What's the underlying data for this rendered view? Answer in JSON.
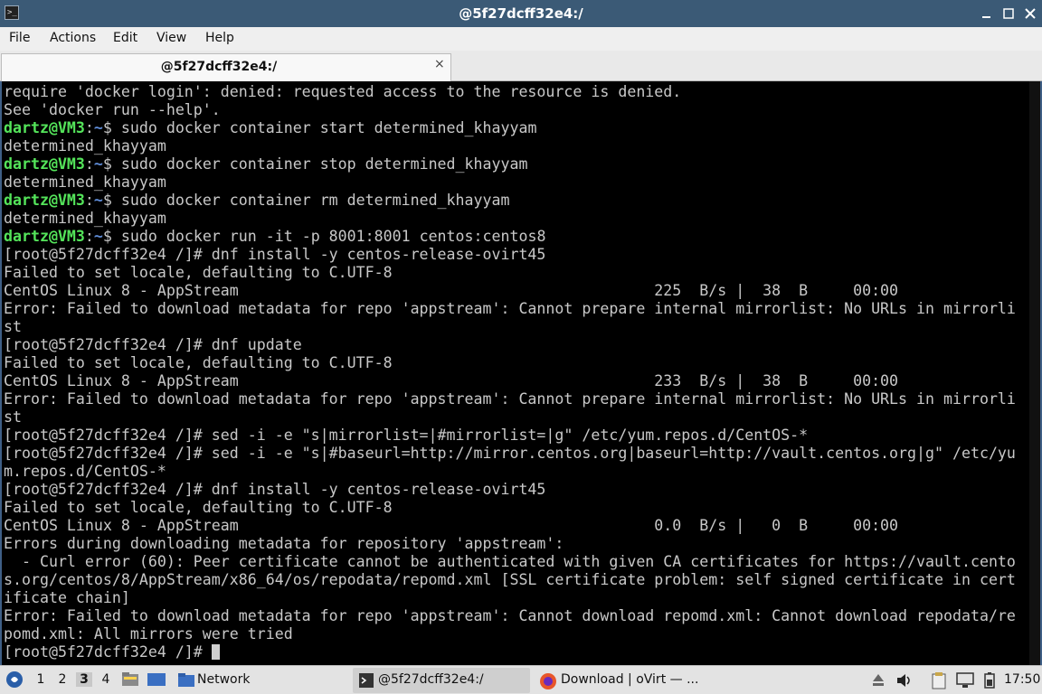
{
  "window": {
    "title": "@5f27dcff32e4:/",
    "minimize_icon": "minimize-icon",
    "maximize_icon": "maximize-icon",
    "close_icon": "close-icon"
  },
  "menu": [
    "File",
    "Actions",
    "Edit",
    "View",
    "Help"
  ],
  "tab": {
    "label": "@5f27dcff32e4:/",
    "close": "×"
  },
  "terminal": {
    "lines": [
      {
        "segments": [
          {
            "text": "require 'docker login': denied: requested access to the resource is denied."
          }
        ]
      },
      {
        "segments": [
          {
            "text": "See 'docker run --help'."
          }
        ]
      },
      {
        "segments": [
          {
            "text": "dartz@VM3",
            "cls": "user"
          },
          {
            "text": ":"
          },
          {
            "text": "~",
            "cls": "path"
          },
          {
            "text": "$ sudo docker container start determined_khayyam"
          }
        ]
      },
      {
        "segments": [
          {
            "text": "determined_khayyam"
          }
        ]
      },
      {
        "segments": [
          {
            "text": "dartz@VM3",
            "cls": "user"
          },
          {
            "text": ":"
          },
          {
            "text": "~",
            "cls": "path"
          },
          {
            "text": "$ sudo docker container stop determined_khayyam"
          }
        ]
      },
      {
        "segments": [
          {
            "text": "determined_khayyam"
          }
        ]
      },
      {
        "segments": [
          {
            "text": "dartz@VM3",
            "cls": "user"
          },
          {
            "text": ":"
          },
          {
            "text": "~",
            "cls": "path"
          },
          {
            "text": "$ sudo docker container rm determined_khayyam"
          }
        ]
      },
      {
        "segments": [
          {
            "text": "determined_khayyam"
          }
        ]
      },
      {
        "segments": [
          {
            "text": "dartz@VM3",
            "cls": "user"
          },
          {
            "text": ":"
          },
          {
            "text": "~",
            "cls": "path"
          },
          {
            "text": "$ sudo docker run -it -p 8001:8001 centos:centos8"
          }
        ]
      },
      {
        "segments": [
          {
            "text": "[root@5f27dcff32e4 /]# dnf install -y centos-release-ovirt45"
          }
        ]
      },
      {
        "segments": [
          {
            "text": "Failed to set locale, defaulting to C.UTF-8"
          }
        ]
      },
      {
        "segments": [
          {
            "text": "CentOS Linux 8 - AppStream                                              225  B/s |  38  B     00:00"
          }
        ]
      },
      {
        "segments": [
          {
            "text": "Error: Failed to download metadata for repo 'appstream': Cannot prepare internal mirrorlist: No URLs in mirrorli"
          }
        ]
      },
      {
        "segments": [
          {
            "text": "st"
          }
        ]
      },
      {
        "segments": [
          {
            "text": "[root@5f27dcff32e4 /]# dnf update"
          }
        ]
      },
      {
        "segments": [
          {
            "text": "Failed to set locale, defaulting to C.UTF-8"
          }
        ]
      },
      {
        "segments": [
          {
            "text": "CentOS Linux 8 - AppStream                                              233  B/s |  38  B     00:00"
          }
        ]
      },
      {
        "segments": [
          {
            "text": "Error: Failed to download metadata for repo 'appstream': Cannot prepare internal mirrorlist: No URLs in mirrorli"
          }
        ]
      },
      {
        "segments": [
          {
            "text": "st"
          }
        ]
      },
      {
        "segments": [
          {
            "text": "[root@5f27dcff32e4 /]# sed -i -e \"s|mirrorlist=|#mirrorlist=|g\" /etc/yum.repos.d/CentOS-*"
          }
        ]
      },
      {
        "segments": [
          {
            "text": "[root@5f27dcff32e4 /]# sed -i -e \"s|#baseurl=http://mirror.centos.org|baseurl=http://vault.centos.org|g\" /etc/yu"
          }
        ]
      },
      {
        "segments": [
          {
            "text": "m.repos.d/CentOS-*"
          }
        ]
      },
      {
        "segments": [
          {
            "text": "[root@5f27dcff32e4 /]# dnf install -y centos-release-ovirt45"
          }
        ]
      },
      {
        "segments": [
          {
            "text": "Failed to set locale, defaulting to C.UTF-8"
          }
        ]
      },
      {
        "segments": [
          {
            "text": "CentOS Linux 8 - AppStream                                              0.0  B/s |   0  B     00:00"
          }
        ]
      },
      {
        "segments": [
          {
            "text": "Errors during downloading metadata for repository 'appstream':"
          }
        ]
      },
      {
        "segments": [
          {
            "text": "  - Curl error (60): Peer certificate cannot be authenticated with given CA certificates for https://vault.cento"
          }
        ]
      },
      {
        "segments": [
          {
            "text": "s.org/centos/8/AppStream/x86_64/os/repodata/repomd.xml [SSL certificate problem: self signed certificate in cert"
          }
        ]
      },
      {
        "segments": [
          {
            "text": "ificate chain]"
          }
        ]
      },
      {
        "segments": [
          {
            "text": "Error: Failed to download metadata for repo 'appstream': Cannot download repomd.xml: Cannot download repodata/re"
          }
        ]
      },
      {
        "segments": [
          {
            "text": "pomd.xml: All mirrors were tried"
          }
        ]
      },
      {
        "segments": [
          {
            "text": "[root@5f27dcff32e4 /]# "
          }
        ],
        "cursor": true
      }
    ]
  },
  "taskbar": {
    "start_icon": "start-menu-icon",
    "workspaces": [
      "1",
      "2",
      "3",
      "4"
    ],
    "active_workspace": "3",
    "network_label": "Network",
    "tasks": [
      {
        "label": "@5f27dcff32e4:/",
        "icon": "terminal-icon",
        "active": true
      },
      {
        "label": "Download | oVirt — ...",
        "icon": "firefox-icon",
        "active": false
      }
    ],
    "clock": "17:50"
  }
}
